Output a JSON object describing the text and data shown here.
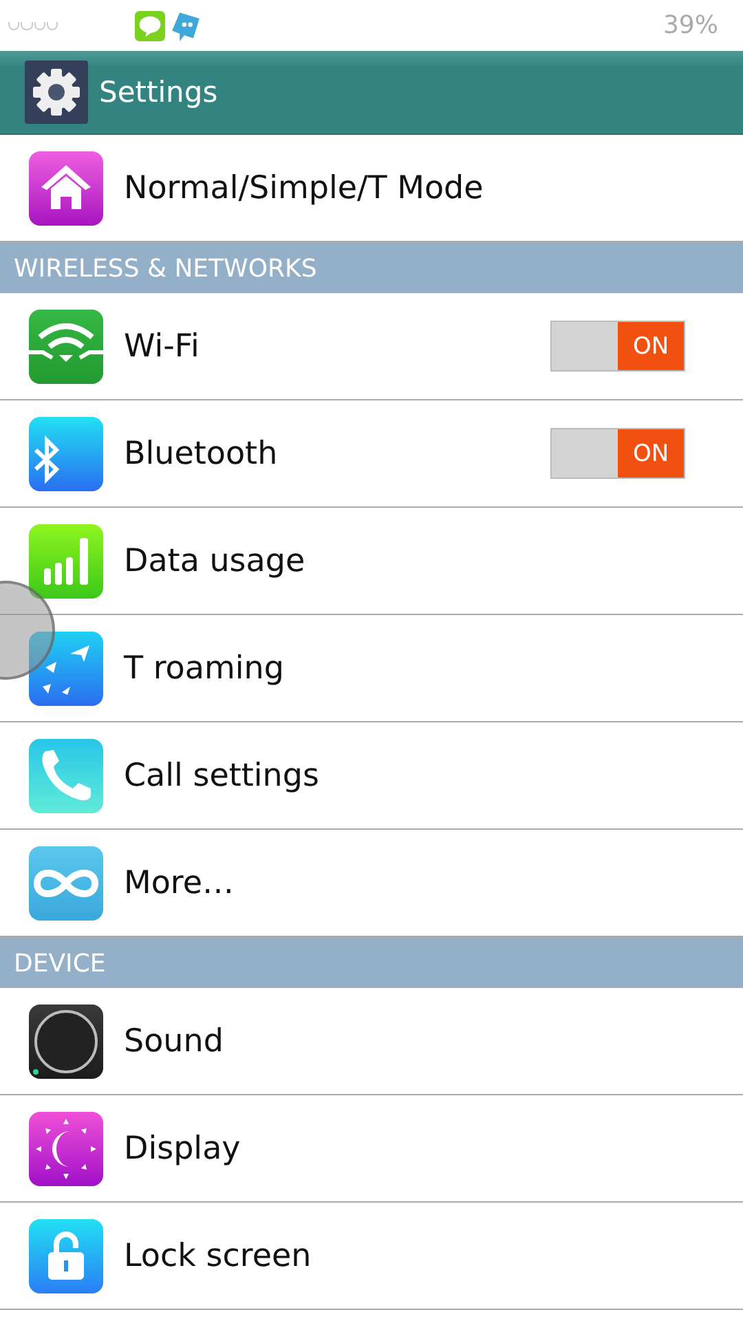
{
  "status_bar": {
    "battery": "39%"
  },
  "app_bar": {
    "title": "Settings"
  },
  "sections": [
    {
      "items": [
        {
          "label": "Normal/Simple/T Mode",
          "kind": "plain"
        }
      ]
    },
    {
      "header": "WIRELESS & NETWORKS",
      "items": [
        {
          "label": "Wi-Fi",
          "kind": "toggle",
          "on": true,
          "toggle_label": "ON"
        },
        {
          "label": "Bluetooth",
          "kind": "toggle",
          "on": true,
          "toggle_label": "ON"
        },
        {
          "label": "Data usage",
          "kind": "plain"
        },
        {
          "label": "T roaming",
          "kind": "plain"
        },
        {
          "label": "Call settings",
          "kind": "plain"
        },
        {
          "label": "More…",
          "kind": "plain"
        }
      ]
    },
    {
      "header": "DEVICE",
      "items": [
        {
          "label": "Sound",
          "kind": "plain"
        },
        {
          "label": "Display",
          "kind": "plain"
        },
        {
          "label": "Lock screen",
          "kind": "plain"
        }
      ]
    }
  ]
}
